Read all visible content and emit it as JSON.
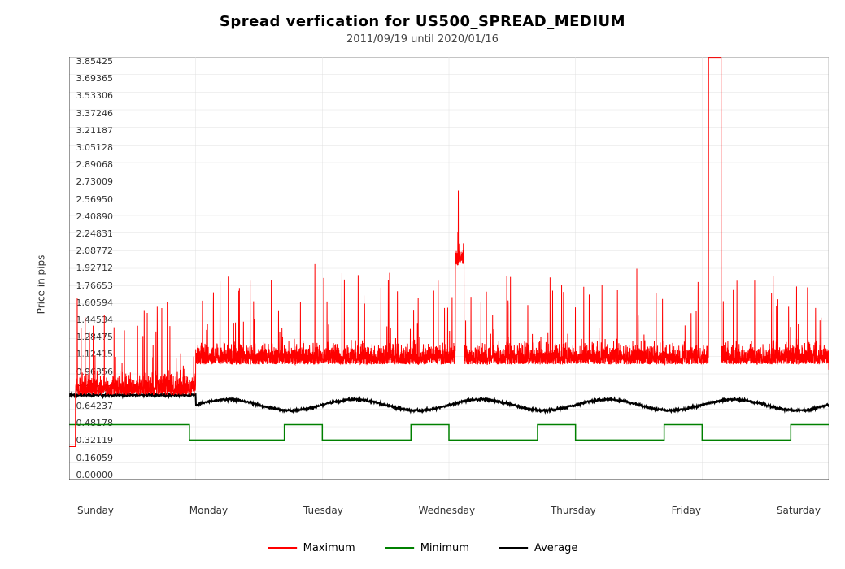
{
  "title": "Spread verfication for US500_SPREAD_MEDIUM",
  "subtitle": "2011/09/19 until 2020/01/16",
  "yAxisLabel": "Price in pips",
  "yTicks": [
    "3.85425",
    "3.69365",
    "3.53306",
    "3.37246",
    "3.21187",
    "3.05128",
    "2.89068",
    "2.73009",
    "2.56950",
    "2.40890",
    "2.24831",
    "2.08772",
    "1.92712",
    "1.76653",
    "1.60594",
    "1.44534",
    "1.28475",
    "1.12415",
    "0.96356",
    "0.80297",
    "0.64237",
    "0.48178",
    "0.32119",
    "0.16059",
    "0.00000"
  ],
  "xTicks": [
    "Sunday",
    "Monday",
    "Tuesday",
    "Wednesday",
    "Thursday",
    "Friday",
    "Saturday"
  ],
  "legend": [
    {
      "label": "Maximum",
      "color": "red"
    },
    {
      "label": "Minimum",
      "color": "green"
    },
    {
      "label": "Average",
      "color": "black"
    }
  ]
}
